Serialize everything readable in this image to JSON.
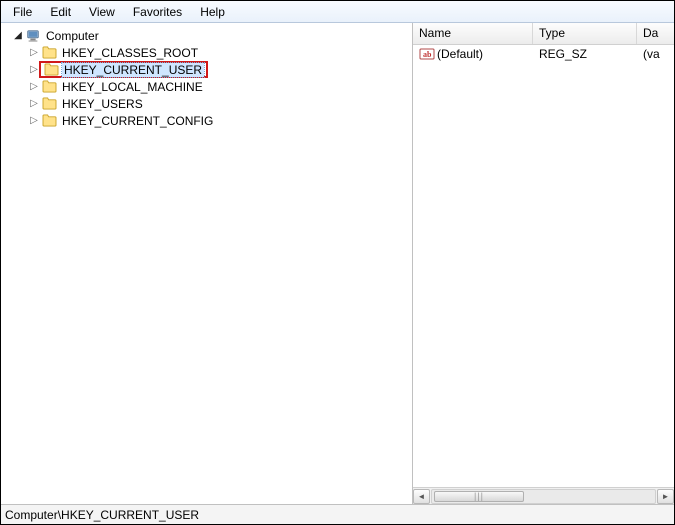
{
  "menu": {
    "items": [
      "File",
      "Edit",
      "View",
      "Favorites",
      "Help"
    ]
  },
  "tree": {
    "root_label": "Computer",
    "hives": [
      {
        "label": "HKEY_CLASSES_ROOT",
        "selected": false,
        "highlighted": false
      },
      {
        "label": "HKEY_CURRENT_USER",
        "selected": true,
        "highlighted": true
      },
      {
        "label": "HKEY_LOCAL_MACHINE",
        "selected": false,
        "highlighted": false
      },
      {
        "label": "HKEY_USERS",
        "selected": false,
        "highlighted": false
      },
      {
        "label": "HKEY_CURRENT_CONFIG",
        "selected": false,
        "highlighted": false
      }
    ]
  },
  "list": {
    "columns": {
      "name": "Name",
      "type": "Type",
      "data": "Da"
    },
    "rows": [
      {
        "name": "(Default)",
        "type": "REG_SZ",
        "data": "(va"
      }
    ]
  },
  "statusbar": {
    "path": "Computer\\HKEY_CURRENT_USER"
  }
}
